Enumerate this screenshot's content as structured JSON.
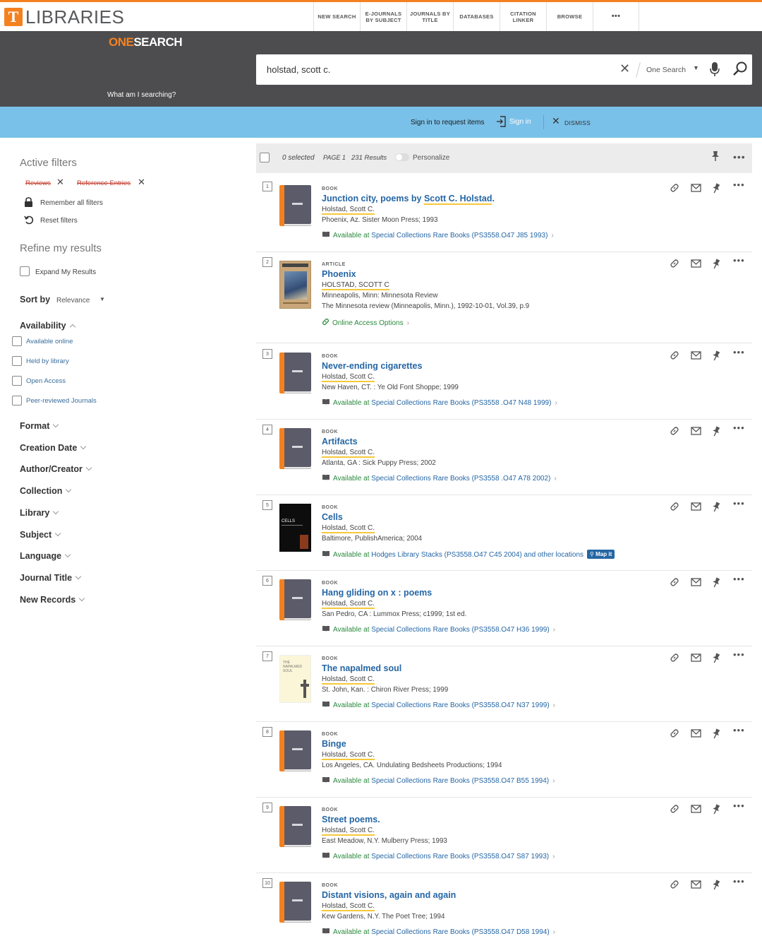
{
  "header": {
    "logo_letter": "T",
    "logo_text": "LIBRARIES",
    "nav": [
      {
        "label": "NEW SEARCH",
        "width": 66
      },
      {
        "label": "E-JOURNALS BY SUBJECT",
        "width": 66
      },
      {
        "label": "JOURNALS BY TITLE",
        "width": 66
      },
      {
        "label": "DATABASES",
        "width": 66
      },
      {
        "label": "CITATION LINKER",
        "width": 66
      },
      {
        "label": "BROWSE",
        "width": 66
      },
      {
        "label": "•••",
        "width": 66
      }
    ]
  },
  "search": {
    "brand_one": "ONE",
    "brand_search": "SEARCH",
    "what": "What am I searching?",
    "query": "holstad, scott c.",
    "clear": "✕",
    "scope": "One Search"
  },
  "signin": {
    "message": "Sign in to request items",
    "signin_label": "Sign in",
    "dismiss_label": "DISMISS"
  },
  "sidebar": {
    "active_filters_title": "Active filters",
    "chips": [
      "Reviews",
      "Reference Entries"
    ],
    "remember": "Remember all filters",
    "reset": "Reset filters",
    "refine_title": "Refine my results",
    "expand": "Expand My Results",
    "sort_label": "Sort by",
    "sort_value": "Relevance",
    "availability": "Availability",
    "availability_options": [
      "Available online",
      "Held by library",
      "Open Access",
      "Peer-reviewed Journals"
    ],
    "facets": [
      "Format",
      "Creation Date",
      "Author/Creator",
      "Collection",
      "Library",
      "Subject",
      "Language",
      "Journal Title",
      "New Records"
    ]
  },
  "results_header": {
    "selected": "0 selected",
    "page": "PAGE 1",
    "count": "231 Results",
    "personalize": "Personalize"
  },
  "results": [
    {
      "num": "1",
      "type": "BOOK",
      "title_pre": "Junction city, poems by ",
      "title_hl": "Scott C. Holstad",
      "title_post": ".",
      "author": "Holstad, Scott C.",
      "pub": "Phoenix, Az. Sister Moon Press; 1993",
      "pub2": "",
      "avail_pre": "Available at ",
      "avail_loc": "Special Collections  Rare Books (PS3558.O47 J85 1993)",
      "avail_post": "",
      "thumb": "book"
    },
    {
      "num": "2",
      "type": "ARTICLE",
      "title_pre": "Phoenix",
      "title_hl": "",
      "title_post": "",
      "author": "HOLSTAD, SCOTT C",
      "pub": "Minneapolis, Minn: Minnesota Review",
      "pub2": "The Minnesota review (Minneapolis, Minn.), 1992-10-01, Vol.39, p.9",
      "avail_pre": "Online Access Options",
      "avail_loc": "",
      "avail_post": "",
      "thumb": "article"
    },
    {
      "num": "3",
      "type": "BOOK",
      "title_pre": "Never-ending cigarettes",
      "title_hl": "",
      "title_post": "",
      "author": "Holstad, Scott C.",
      "pub": "New Haven, CT. : Ye Old Font Shoppe; 1999",
      "pub2": "",
      "avail_pre": "Available at ",
      "avail_loc": "Special Collections  Rare Books (PS3558 .O47 N48 1999)",
      "avail_post": "",
      "thumb": "book"
    },
    {
      "num": "4",
      "type": "BOOK",
      "title_pre": "Artifacts",
      "title_hl": "",
      "title_post": "",
      "author": "Holstad, Scott C.",
      "pub": "Atlanta, GA : Sick Puppy Press; 2002",
      "pub2": "",
      "avail_pre": "Available at ",
      "avail_loc": "Special Collections  Rare Books (PS3558 .O47 A78 2002)",
      "avail_post": "",
      "thumb": "book"
    },
    {
      "num": "5",
      "type": "BOOK",
      "title_pre": "Cells",
      "title_hl": "",
      "title_post": "",
      "author": "Holstad, Scott C.",
      "pub": "Baltimore, PublishAmerica; 2004",
      "pub2": "",
      "avail_pre": "Available at ",
      "avail_loc": "Hodges Library  Stacks (PS3558.O47 C45 2004) and other locations",
      "avail_post": "Map it",
      "thumb": "cells"
    },
    {
      "num": "6",
      "type": "BOOK",
      "title_pre": "Hang gliding on x : poems",
      "title_hl": "",
      "title_post": "",
      "author": "Holstad, Scott C.",
      "pub": "San Pedro, CA : Lummox Press; c1999; 1st ed.",
      "pub2": "",
      "avail_pre": "Available at ",
      "avail_loc": "Special Collections  Rare Books (PS3558.O47 H36 1999)",
      "avail_post": "",
      "thumb": "book"
    },
    {
      "num": "7",
      "type": "BOOK",
      "title_pre": "The napalmed soul",
      "title_hl": "",
      "title_post": "",
      "author": "Holstad, Scott C.",
      "pub": "St. John, Kan. : Chiron River Press; 1999",
      "pub2": "",
      "avail_pre": "Available at ",
      "avail_loc": "Special Collections  Rare Books (PS3558.O47 N37 1999)",
      "avail_post": "",
      "thumb": "napalmed"
    },
    {
      "num": "8",
      "type": "BOOK",
      "title_pre": "Binge",
      "title_hl": "",
      "title_post": "",
      "author": "Holstad, Scott C.",
      "pub": "Los Angeles, CA. Undulating Bedsheets Productions; 1994",
      "pub2": "",
      "avail_pre": "Available at ",
      "avail_loc": "Special Collections  Rare Books (PS3558.O47 B55 1994)",
      "avail_post": "",
      "thumb": "book"
    },
    {
      "num": "9",
      "type": "BOOK",
      "title_pre": "Street poems.",
      "title_hl": "",
      "title_post": "",
      "author": "Holstad, Scott C.",
      "pub": "East Meadow, N.Y. Mulberry Press; 1993",
      "pub2": "",
      "avail_pre": "Available at ",
      "avail_loc": "Special Collections  Rare Books (PS3558.O47 S87 1993)",
      "avail_post": "",
      "thumb": "book"
    },
    {
      "num": "10",
      "type": "BOOK",
      "title_pre": "Distant visions, again and again",
      "title_hl": "",
      "title_post": "",
      "author": "Holstad, Scott C.",
      "pub": "Kew Gardens, N.Y. The Poet Tree; 1994",
      "pub2": "",
      "avail_pre": "Available at ",
      "avail_loc": "Special Collections  Rare Books (PS3558.O47 D58 1994)",
      "avail_post": "",
      "thumb": "book"
    }
  ],
  "cover_text": {
    "cells": "CELLS",
    "napalmed": "THE NAPALMED SOUL"
  },
  "colors": {
    "accent": "#f48120",
    "link": "#2566a4",
    "available": "#2a8a3e",
    "band_dark": "#4d4d4f",
    "band_blue": "#7ac1e9"
  }
}
